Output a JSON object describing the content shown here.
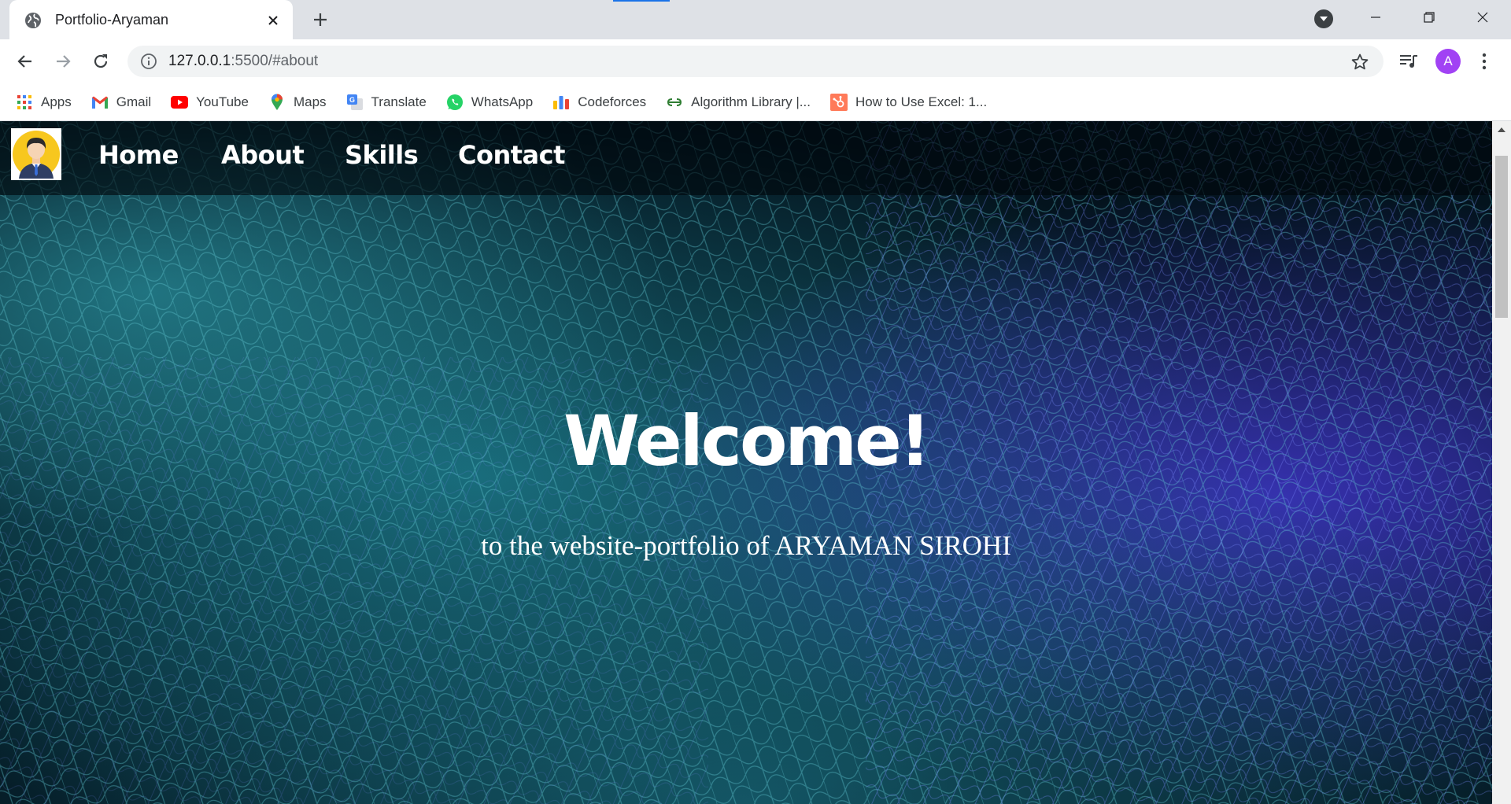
{
  "browser": {
    "tab": {
      "title": "Portfolio-Aryaman"
    },
    "address": {
      "host": "127.0.0.1",
      "rest": ":5500/#about"
    },
    "profile_initial": "A",
    "bookmarks": [
      {
        "label": "Apps",
        "icon": "apps-grid-icon"
      },
      {
        "label": "Gmail",
        "icon": "gmail-icon"
      },
      {
        "label": "YouTube",
        "icon": "youtube-icon"
      },
      {
        "label": "Maps",
        "icon": "maps-pin-icon"
      },
      {
        "label": "Translate",
        "icon": "translate-icon"
      },
      {
        "label": "WhatsApp",
        "icon": "whatsapp-icon"
      },
      {
        "label": "Codeforces",
        "icon": "codeforces-icon"
      },
      {
        "label": "Algorithm Library |...",
        "icon": "algorithm-library-icon"
      },
      {
        "label": "How to Use Excel: 1...",
        "icon": "hubspot-icon"
      }
    ]
  },
  "site": {
    "nav": {
      "home": "Home",
      "about": "About",
      "skills": "Skills",
      "contact": "Contact"
    },
    "hero": {
      "title": "Welcome!",
      "subtitle": "to the website-portfolio of ARYAMAN SIROHI"
    }
  },
  "colors": {
    "accent": "#1a73e8",
    "avatar": "#a142f4",
    "hero_dark": "#03131d",
    "hero_teal": "#1d7c8c",
    "hero_blue": "#4338d4"
  }
}
